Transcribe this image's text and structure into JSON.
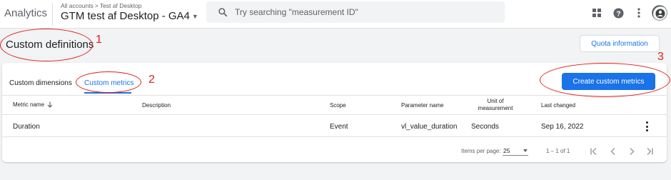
{
  "header": {
    "app_name": "Analytics",
    "breadcrumb": {
      "root": "All accounts",
      "separator": ">",
      "account": "Test af Desktop"
    },
    "property_name": "GTM test af Desktop - GA4",
    "search_placeholder": "Try searching \"measurement ID\""
  },
  "page": {
    "title": "Custom definitions",
    "quota_button": "Quota information"
  },
  "tabs": [
    {
      "label": "Custom dimensions",
      "active": false
    },
    {
      "label": "Custom metrics",
      "active": true
    }
  ],
  "create_button": "Create custom metrics",
  "table": {
    "columns": {
      "metric_name": "Metric name",
      "description": "Description",
      "scope": "Scope",
      "parameter_name": "Parameter name",
      "unit_line1": "Unit of",
      "unit_line2": "measurement",
      "last_changed": "Last changed"
    },
    "rows": [
      {
        "metric_name": "Duration",
        "description": "",
        "scope": "Event",
        "parameter_name": "vl_value_duration",
        "unit": "Seconds",
        "last_changed": "Sep 16, 2022"
      }
    ]
  },
  "pagination": {
    "items_per_page_label": "Items per page:",
    "items_per_page_value": "25",
    "range": "1 – 1 of 1"
  },
  "annotations": {
    "n1": "1",
    "n2": "2",
    "n3": "3"
  },
  "colors": {
    "accent": "#1a73e8",
    "annotation": "#e0201c",
    "background": "#f1f3f4"
  }
}
